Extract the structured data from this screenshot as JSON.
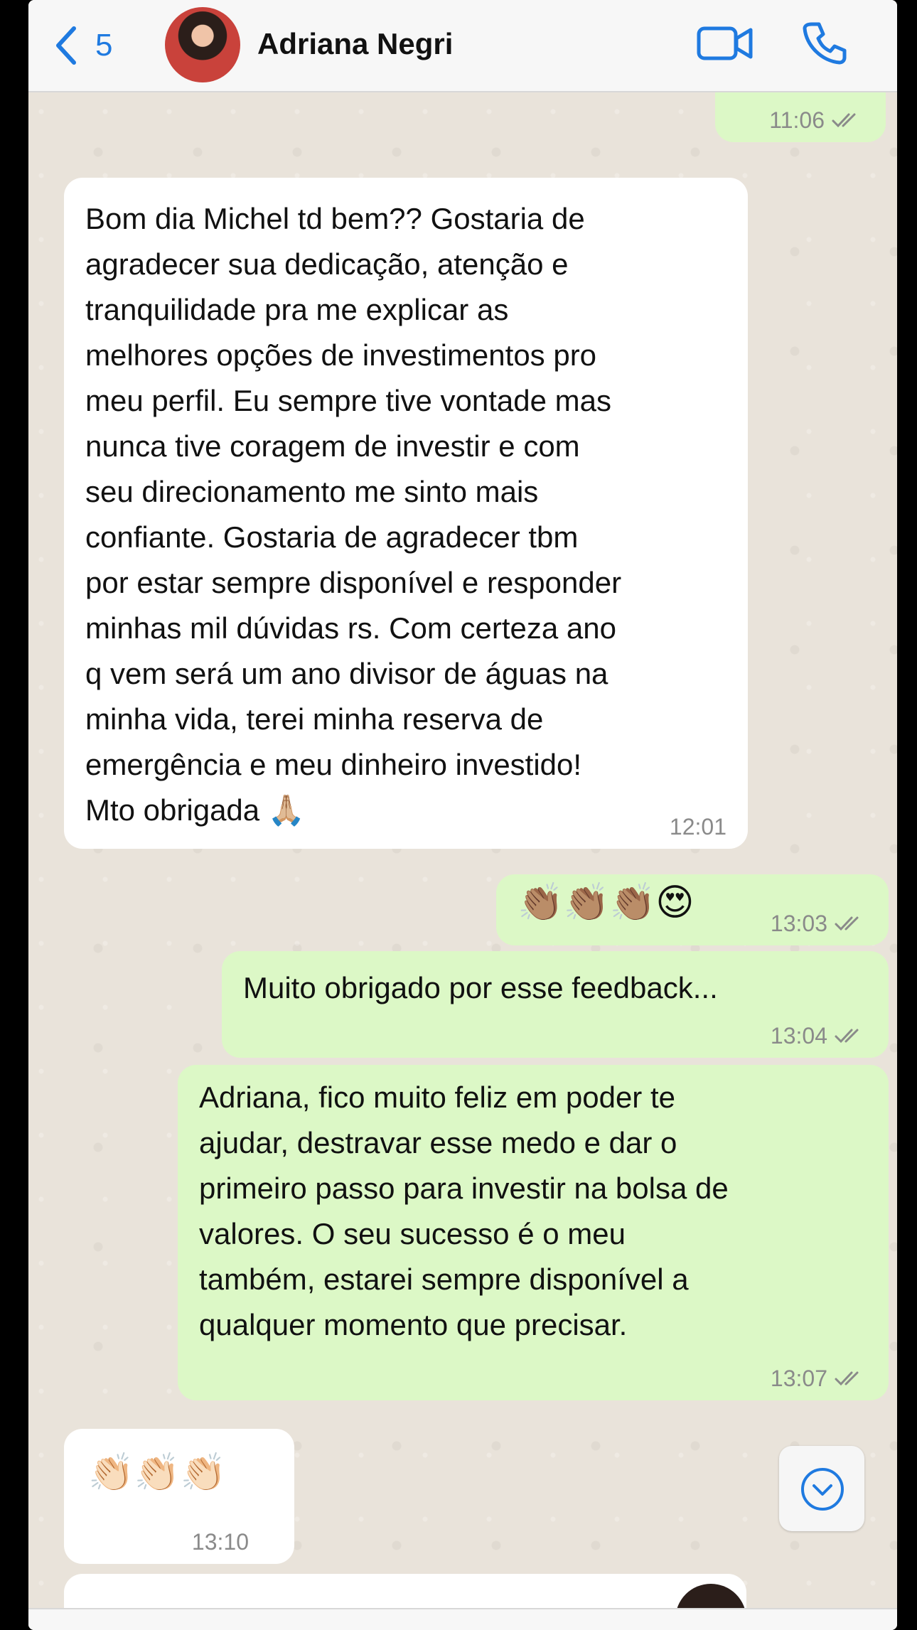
{
  "header": {
    "back_count": "5",
    "contact_name": "Adriana Negri"
  },
  "messages": [
    {
      "direction": "out",
      "text": "",
      "time": "11:06",
      "read": true
    },
    {
      "direction": "in",
      "text": "Bom dia Michel td bem?? Gostaria de\nagradecer sua dedicação, atenção e\ntranquilidade pra me explicar as\nmelhores opções de investimentos pro\nmeu perfil. Eu sempre tive vontade mas\nnunca tive coragem de investir e com\nseu direcionamento me sinto mais\nconfiante. Gostaria de agradecer tbm\npor estar sempre disponível e responder\nminhas mil dúvidas rs. Com certeza ano\nq vem será um ano divisor de águas na\nminha vida, terei minha reserva de\nemergência e meu dinheiro investido!\nMto obrigada 🙏🏼",
      "time": "12:01"
    },
    {
      "direction": "out",
      "text": "👏🏽👏🏽👏🏽😍",
      "time": "13:03",
      "read": true
    },
    {
      "direction": "out",
      "text": "Muito obrigado por esse feedback...",
      "time": "13:04",
      "read": true
    },
    {
      "direction": "out",
      "text": "Adriana, fico muito feliz em poder te\najudar, destravar esse medo e dar o\nprimeiro passo para investir na bolsa de\nvalores. O seu sucesso é o meu\ntambém, estarei sempre disponível a\nqualquer momento que precisar.",
      "time": "13:07",
      "read": true
    },
    {
      "direction": "in",
      "text": "👏🏻👏🏻👏🏻",
      "time": "13:10"
    }
  ],
  "colors": {
    "accent": "#1f7ae0",
    "incoming_bubble": "#ffffff",
    "outgoing_bubble": "#dcf8c6",
    "read_ticks": "#8a8a8a"
  },
  "icons": [
    "chevron-left-icon",
    "video-camera-icon",
    "phone-icon",
    "double-check-icon",
    "scroll-down-icon"
  ]
}
